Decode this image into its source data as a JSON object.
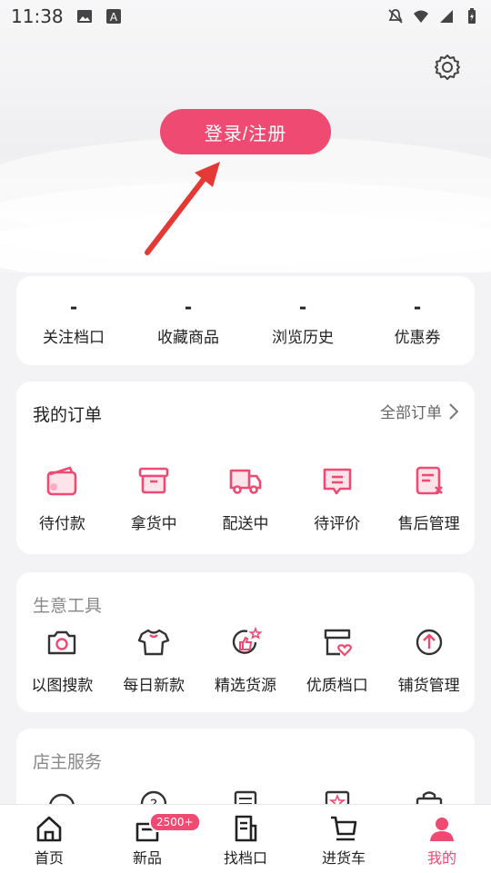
{
  "status_bar": {
    "time": "11:38"
  },
  "header": {
    "login_label": "登录/注册"
  },
  "stats": [
    {
      "value": "-",
      "label": "关注档口"
    },
    {
      "value": "-",
      "label": "收藏商品"
    },
    {
      "value": "-",
      "label": "浏览历史"
    },
    {
      "value": "-",
      "label": "优惠券"
    }
  ],
  "orders": {
    "title": "我的订单",
    "all_label": "全部订单",
    "items": [
      {
        "label": "待付款",
        "icon": "wallet-icon"
      },
      {
        "label": "拿货中",
        "icon": "box-icon"
      },
      {
        "label": "配送中",
        "icon": "truck-icon"
      },
      {
        "label": "待评价",
        "icon": "comment-icon"
      },
      {
        "label": "售后管理",
        "icon": "after-sale-icon"
      }
    ]
  },
  "tools": {
    "title": "生意工具",
    "items": [
      {
        "label": "以图搜款",
        "icon": "camera-icon"
      },
      {
        "label": "每日新款",
        "icon": "tshirt-icon"
      },
      {
        "label": "精选货源",
        "icon": "thumbs-up-icon"
      },
      {
        "label": "优质档口",
        "icon": "shop-heart-icon"
      },
      {
        "label": "铺货管理",
        "icon": "upload-icon"
      }
    ]
  },
  "service": {
    "title": "店主服务"
  },
  "tabbar": {
    "items": [
      {
        "label": "首页",
        "icon": "home-icon"
      },
      {
        "label": "新品",
        "icon": "new-icon",
        "badge": "2500+"
      },
      {
        "label": "找档口",
        "icon": "document-icon"
      },
      {
        "label": "进货车",
        "icon": "cart-icon"
      },
      {
        "label": "我的",
        "icon": "user-icon",
        "active": true
      }
    ]
  },
  "colors": {
    "accent": "#ef4a72",
    "arrow": "#e53935",
    "background": "#f3f3f5"
  }
}
